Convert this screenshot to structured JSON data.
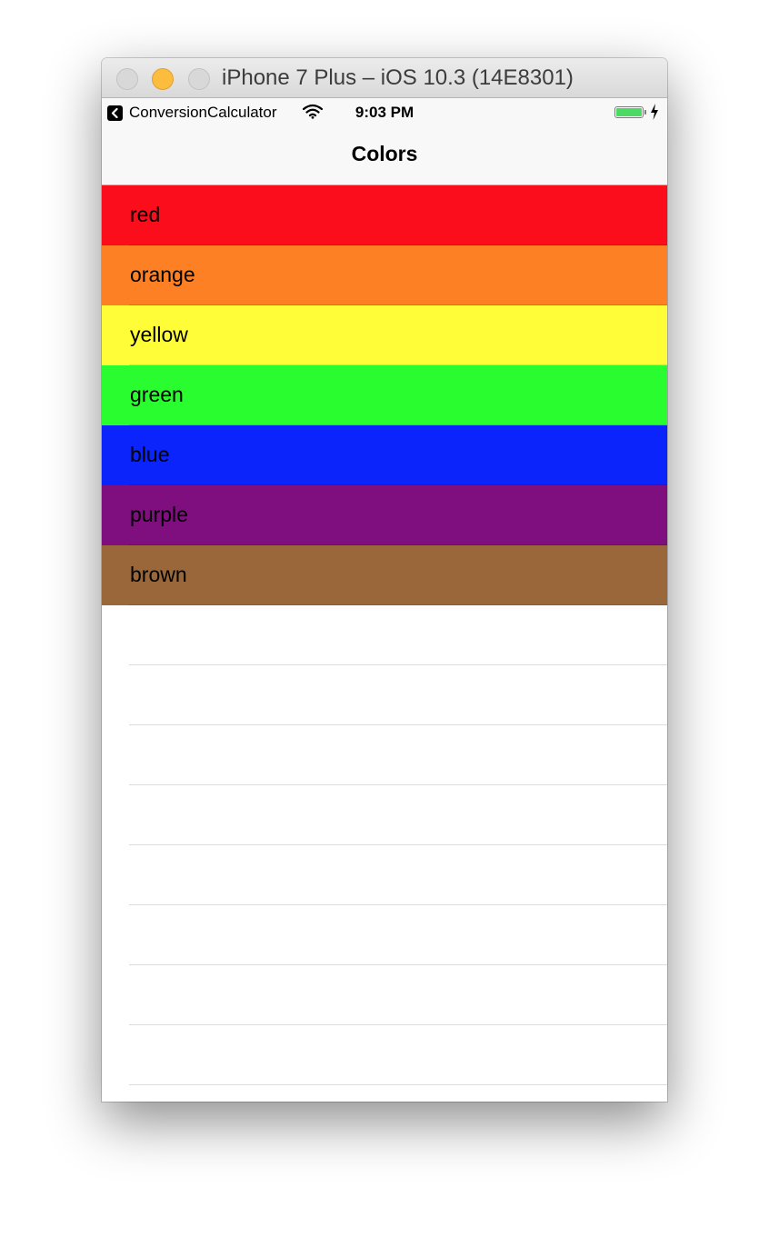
{
  "window": {
    "title": "iPhone 7 Plus – iOS 10.3 (14E8301)"
  },
  "status_bar": {
    "back_app": "ConversionCalculator",
    "time": "9:03 PM",
    "back_icon": "back-chevron-icon",
    "wifi_icon": "wifi-icon",
    "battery_icon": "battery-icon",
    "charging_icon": "lightning-bolt-icon",
    "battery_level": 1.0
  },
  "nav": {
    "title": "Colors"
  },
  "colors": [
    {
      "label": "red",
      "color": "#fc0d1b"
    },
    {
      "label": "orange",
      "color": "#fd8024"
    },
    {
      "label": "yellow",
      "color": "#fffd38"
    },
    {
      "label": "green",
      "color": "#29fd2f"
    },
    {
      "label": "blue",
      "color": "#0b24fb"
    },
    {
      "label": "purple",
      "color": "#7f0f7e"
    },
    {
      "label": "brown",
      "color": "#996739"
    }
  ]
}
